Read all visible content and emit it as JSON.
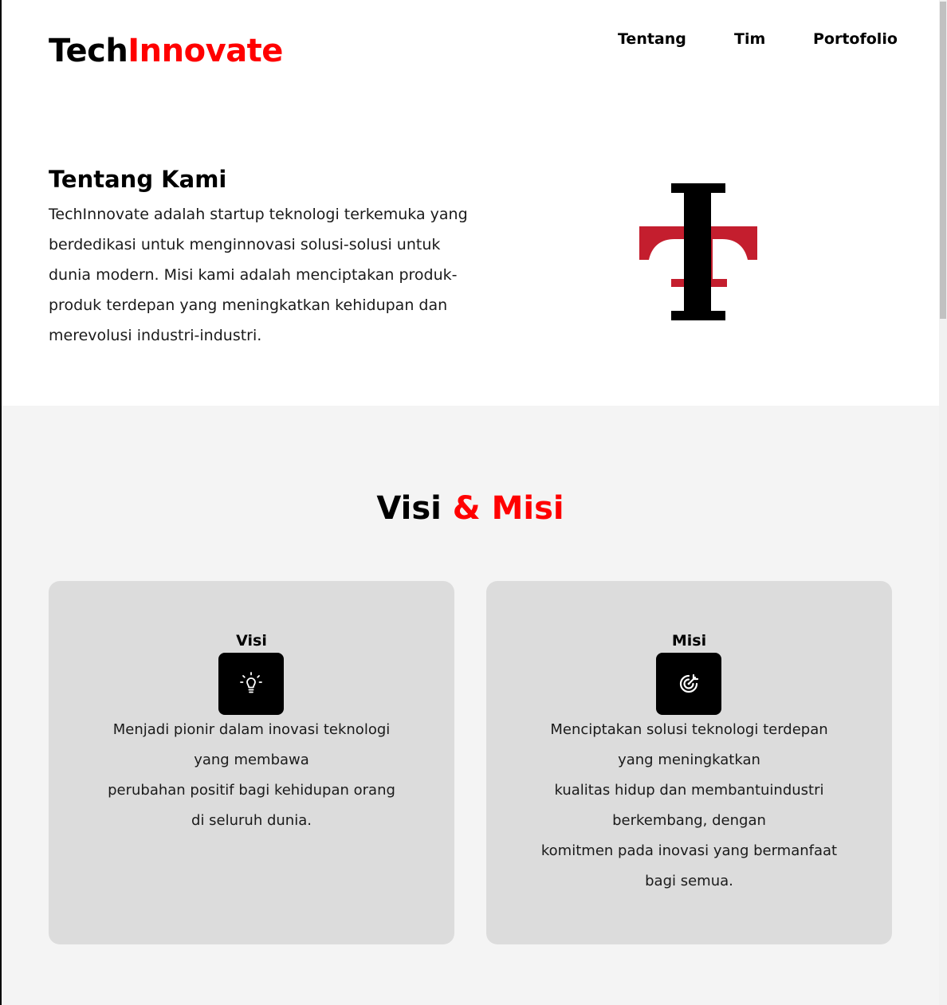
{
  "header": {
    "logo_part1": "Tech",
    "logo_part2": "Innovate",
    "nav": [
      "Tentang",
      "Tim",
      "Portofolio"
    ]
  },
  "about": {
    "title": "Tentang Kami",
    "text": "TechInnovate adalah startup teknologi terkemuka yang berdedikasi untuk menginnovasi solusi-solusi untuk dunia modern. Misi kami adalah menciptakan produk-produk terdepan yang meningkatkan kehidupan dan merevolusi industri-industri."
  },
  "visi_misi": {
    "title_part1": "Visi",
    "title_part2": "& Misi",
    "cards": [
      {
        "title": "Visi",
        "icon": "lightbulb-icon",
        "lines": [
          "Menjadi pionir dalam inovasi teknologi",
          "yang membawa",
          "perubahan positif bagi kehidupan orang",
          "di seluruh dunia."
        ]
      },
      {
        "title": "Misi",
        "icon": "target-icon",
        "lines": [
          "Menciptakan solusi teknologi terdepan",
          "yang meningkatkan",
          "kualitas hidup dan membantuindustri",
          "berkembang, dengan",
          "komitmen pada inovasi yang bermanfaat",
          "bagi semua."
        ]
      }
    ]
  },
  "colors": {
    "accent": "#ff0000",
    "logo_red": "#c41e2e",
    "section_bg": "#f4f4f4",
    "card_bg": "#dcdcdc"
  }
}
